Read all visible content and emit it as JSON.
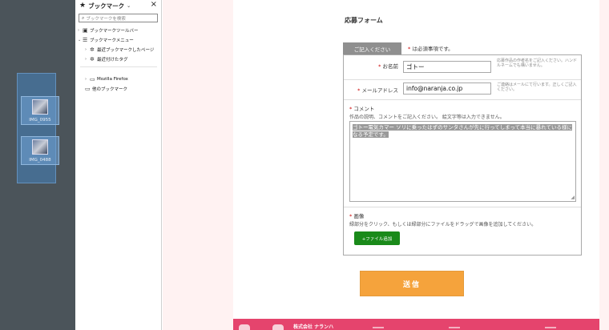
{
  "desktop": {
    "icons": [
      {
        "label": "IMG_0955"
      },
      {
        "label": "IMG_0488"
      }
    ]
  },
  "sidebar": {
    "title": "ブックマーク",
    "search_placeholder": "ブックマークを検索",
    "items": [
      {
        "label": "ブックマークツールバー"
      },
      {
        "label": "ブックマークメニュー"
      },
      {
        "label": "最近ブックマークしたページ"
      },
      {
        "label": "最近付けたタグ"
      },
      {
        "label": "Mozilla Firefox"
      },
      {
        "label": "他のブックマーク"
      }
    ]
  },
  "form": {
    "title": "応募フォーム",
    "tab_label": "ご記入ください",
    "required_note": "は必須事項です。",
    "required_mark": "*",
    "name_label": "お名前",
    "name_value": "ゴトー",
    "name_hint": "応募作品の作者名をご記入ください。ハンドルネームでも構いません。",
    "email_label": "メールアドレス",
    "email_value": "info@naranja.co.jp",
    "email_hint": "ご連絡はメールにて行います。正しくご記入ください。",
    "comment_label": "コメント",
    "comment_desc": "作品の説明、コメントをご記入ください。 絵文字等は入力できません。",
    "comment_value": "ゴトー電気カマー ソリに乗ったはずのサンタさんが先に行ってしまって本当に暴れている様になる予定です。",
    "image_label": "画像",
    "image_desc": "緑部分をクリック、もしくは緑部分にファイルをドラッグで画像を追加してください。",
    "add_file_label": "+ファイル追加",
    "submit_label": "送信"
  },
  "footer": {
    "company": "株式会社 ナランハ"
  }
}
